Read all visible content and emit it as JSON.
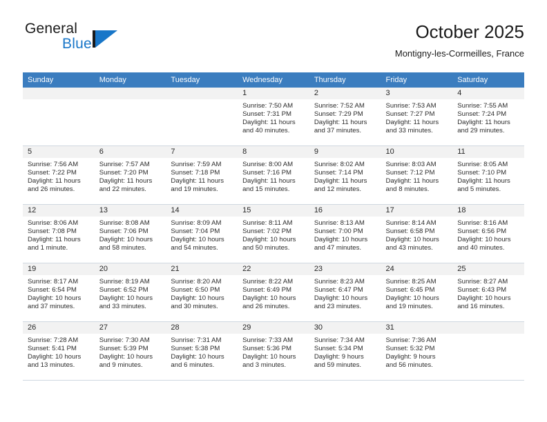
{
  "brand": {
    "name_part1": "General",
    "name_part2": "Blue",
    "logo_icon": "triangle-flag-icon",
    "accent_color": "#1876c8"
  },
  "header": {
    "title": "October 2025",
    "subtitle": "Montigny-les-Cormeilles, France"
  },
  "theme": {
    "header_row_bg": "#3b7dbf",
    "daynum_band_bg": "#f2f2f2",
    "grid_line": "#cfd8e0"
  },
  "weekdays": [
    "Sunday",
    "Monday",
    "Tuesday",
    "Wednesday",
    "Thursday",
    "Friday",
    "Saturday"
  ],
  "weeks": [
    [
      {
        "day": "",
        "sunrise": "",
        "sunset": "",
        "daylight_line1": "",
        "daylight_line2": "",
        "empty": true
      },
      {
        "day": "",
        "sunrise": "",
        "sunset": "",
        "daylight_line1": "",
        "daylight_line2": "",
        "empty": true
      },
      {
        "day": "",
        "sunrise": "",
        "sunset": "",
        "daylight_line1": "",
        "daylight_line2": "",
        "empty": true
      },
      {
        "day": "1",
        "sunrise": "Sunrise: 7:50 AM",
        "sunset": "Sunset: 7:31 PM",
        "daylight_line1": "Daylight: 11 hours",
        "daylight_line2": "and 40 minutes."
      },
      {
        "day": "2",
        "sunrise": "Sunrise: 7:52 AM",
        "sunset": "Sunset: 7:29 PM",
        "daylight_line1": "Daylight: 11 hours",
        "daylight_line2": "and 37 minutes."
      },
      {
        "day": "3",
        "sunrise": "Sunrise: 7:53 AM",
        "sunset": "Sunset: 7:27 PM",
        "daylight_line1": "Daylight: 11 hours",
        "daylight_line2": "and 33 minutes."
      },
      {
        "day": "4",
        "sunrise": "Sunrise: 7:55 AM",
        "sunset": "Sunset: 7:24 PM",
        "daylight_line1": "Daylight: 11 hours",
        "daylight_line2": "and 29 minutes."
      }
    ],
    [
      {
        "day": "5",
        "sunrise": "Sunrise: 7:56 AM",
        "sunset": "Sunset: 7:22 PM",
        "daylight_line1": "Daylight: 11 hours",
        "daylight_line2": "and 26 minutes."
      },
      {
        "day": "6",
        "sunrise": "Sunrise: 7:57 AM",
        "sunset": "Sunset: 7:20 PM",
        "daylight_line1": "Daylight: 11 hours",
        "daylight_line2": "and 22 minutes."
      },
      {
        "day": "7",
        "sunrise": "Sunrise: 7:59 AM",
        "sunset": "Sunset: 7:18 PM",
        "daylight_line1": "Daylight: 11 hours",
        "daylight_line2": "and 19 minutes."
      },
      {
        "day": "8",
        "sunrise": "Sunrise: 8:00 AM",
        "sunset": "Sunset: 7:16 PM",
        "daylight_line1": "Daylight: 11 hours",
        "daylight_line2": "and 15 minutes."
      },
      {
        "day": "9",
        "sunrise": "Sunrise: 8:02 AM",
        "sunset": "Sunset: 7:14 PM",
        "daylight_line1": "Daylight: 11 hours",
        "daylight_line2": "and 12 minutes."
      },
      {
        "day": "10",
        "sunrise": "Sunrise: 8:03 AM",
        "sunset": "Sunset: 7:12 PM",
        "daylight_line1": "Daylight: 11 hours",
        "daylight_line2": "and 8 minutes."
      },
      {
        "day": "11",
        "sunrise": "Sunrise: 8:05 AM",
        "sunset": "Sunset: 7:10 PM",
        "daylight_line1": "Daylight: 11 hours",
        "daylight_line2": "and 5 minutes."
      }
    ],
    [
      {
        "day": "12",
        "sunrise": "Sunrise: 8:06 AM",
        "sunset": "Sunset: 7:08 PM",
        "daylight_line1": "Daylight: 11 hours",
        "daylight_line2": "and 1 minute."
      },
      {
        "day": "13",
        "sunrise": "Sunrise: 8:08 AM",
        "sunset": "Sunset: 7:06 PM",
        "daylight_line1": "Daylight: 10 hours",
        "daylight_line2": "and 58 minutes."
      },
      {
        "day": "14",
        "sunrise": "Sunrise: 8:09 AM",
        "sunset": "Sunset: 7:04 PM",
        "daylight_line1": "Daylight: 10 hours",
        "daylight_line2": "and 54 minutes."
      },
      {
        "day": "15",
        "sunrise": "Sunrise: 8:11 AM",
        "sunset": "Sunset: 7:02 PM",
        "daylight_line1": "Daylight: 10 hours",
        "daylight_line2": "and 50 minutes."
      },
      {
        "day": "16",
        "sunrise": "Sunrise: 8:13 AM",
        "sunset": "Sunset: 7:00 PM",
        "daylight_line1": "Daylight: 10 hours",
        "daylight_line2": "and 47 minutes."
      },
      {
        "day": "17",
        "sunrise": "Sunrise: 8:14 AM",
        "sunset": "Sunset: 6:58 PM",
        "daylight_line1": "Daylight: 10 hours",
        "daylight_line2": "and 43 minutes."
      },
      {
        "day": "18",
        "sunrise": "Sunrise: 8:16 AM",
        "sunset": "Sunset: 6:56 PM",
        "daylight_line1": "Daylight: 10 hours",
        "daylight_line2": "and 40 minutes."
      }
    ],
    [
      {
        "day": "19",
        "sunrise": "Sunrise: 8:17 AM",
        "sunset": "Sunset: 6:54 PM",
        "daylight_line1": "Daylight: 10 hours",
        "daylight_line2": "and 37 minutes."
      },
      {
        "day": "20",
        "sunrise": "Sunrise: 8:19 AM",
        "sunset": "Sunset: 6:52 PM",
        "daylight_line1": "Daylight: 10 hours",
        "daylight_line2": "and 33 minutes."
      },
      {
        "day": "21",
        "sunrise": "Sunrise: 8:20 AM",
        "sunset": "Sunset: 6:50 PM",
        "daylight_line1": "Daylight: 10 hours",
        "daylight_line2": "and 30 minutes."
      },
      {
        "day": "22",
        "sunrise": "Sunrise: 8:22 AM",
        "sunset": "Sunset: 6:49 PM",
        "daylight_line1": "Daylight: 10 hours",
        "daylight_line2": "and 26 minutes."
      },
      {
        "day": "23",
        "sunrise": "Sunrise: 8:23 AM",
        "sunset": "Sunset: 6:47 PM",
        "daylight_line1": "Daylight: 10 hours",
        "daylight_line2": "and 23 minutes."
      },
      {
        "day": "24",
        "sunrise": "Sunrise: 8:25 AM",
        "sunset": "Sunset: 6:45 PM",
        "daylight_line1": "Daylight: 10 hours",
        "daylight_line2": "and 19 minutes."
      },
      {
        "day": "25",
        "sunrise": "Sunrise: 8:27 AM",
        "sunset": "Sunset: 6:43 PM",
        "daylight_line1": "Daylight: 10 hours",
        "daylight_line2": "and 16 minutes."
      }
    ],
    [
      {
        "day": "26",
        "sunrise": "Sunrise: 7:28 AM",
        "sunset": "Sunset: 5:41 PM",
        "daylight_line1": "Daylight: 10 hours",
        "daylight_line2": "and 13 minutes."
      },
      {
        "day": "27",
        "sunrise": "Sunrise: 7:30 AM",
        "sunset": "Sunset: 5:39 PM",
        "daylight_line1": "Daylight: 10 hours",
        "daylight_line2": "and 9 minutes."
      },
      {
        "day": "28",
        "sunrise": "Sunrise: 7:31 AM",
        "sunset": "Sunset: 5:38 PM",
        "daylight_line1": "Daylight: 10 hours",
        "daylight_line2": "and 6 minutes."
      },
      {
        "day": "29",
        "sunrise": "Sunrise: 7:33 AM",
        "sunset": "Sunset: 5:36 PM",
        "daylight_line1": "Daylight: 10 hours",
        "daylight_line2": "and 3 minutes."
      },
      {
        "day": "30",
        "sunrise": "Sunrise: 7:34 AM",
        "sunset": "Sunset: 5:34 PM",
        "daylight_line1": "Daylight: 9 hours",
        "daylight_line2": "and 59 minutes."
      },
      {
        "day": "31",
        "sunrise": "Sunrise: 7:36 AM",
        "sunset": "Sunset: 5:32 PM",
        "daylight_line1": "Daylight: 9 hours",
        "daylight_line2": "and 56 minutes."
      },
      {
        "day": "",
        "sunrise": "",
        "sunset": "",
        "daylight_line1": "",
        "daylight_line2": "",
        "empty": true
      }
    ]
  ]
}
